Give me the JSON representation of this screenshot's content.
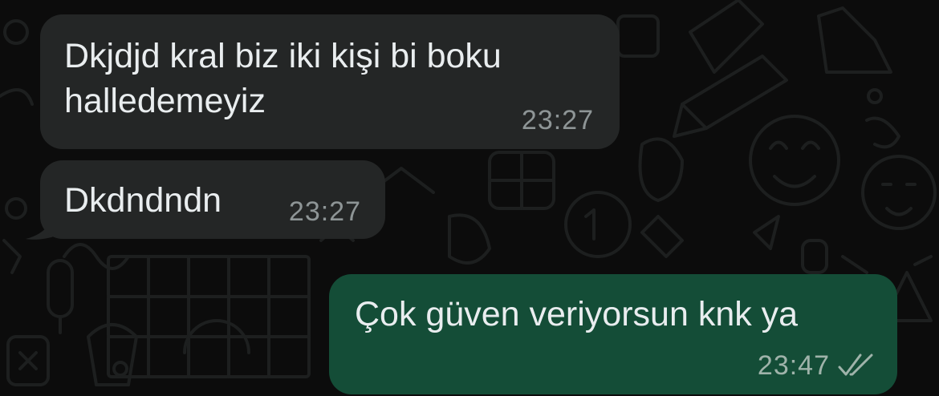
{
  "messages": [
    {
      "direction": "incoming",
      "text": "Dkjdjd kral biz iki kişi bi boku\nhalledemeyiz",
      "time": "23:27"
    },
    {
      "direction": "incoming",
      "text": "Dkdndndn",
      "time": "23:27"
    },
    {
      "direction": "outgoing",
      "text": "Çok güven veriyorsun knk ya",
      "time": "23:47",
      "status_icon": "double-check-icon"
    }
  ],
  "colors": {
    "background": "#0c0c0c",
    "incoming_bubble": "#242626",
    "outgoing_bubble": "#144d37",
    "message_text": "#e9edef",
    "timestamp": "#8e9596"
  }
}
